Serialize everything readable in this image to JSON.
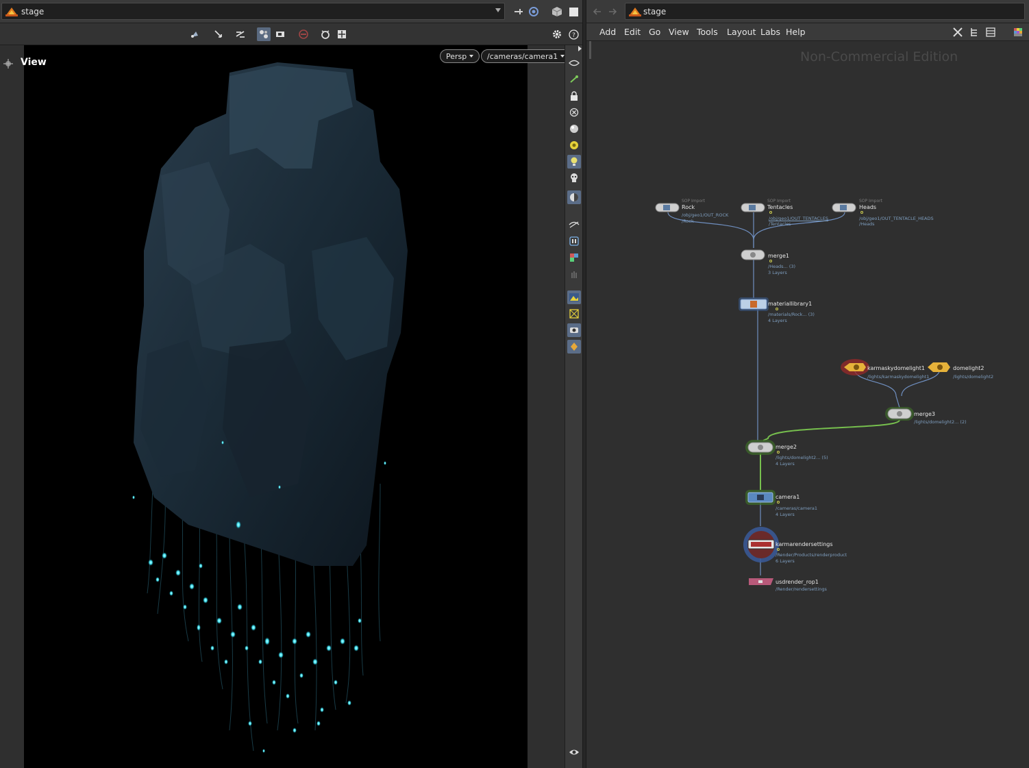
{
  "left_pane": {
    "path_label": "stage",
    "view_title": "View",
    "camera_mode": "Persp",
    "camera_path": "/cameras/camera1"
  },
  "right_pane": {
    "path_label": "stage",
    "menu": [
      "Add",
      "Edit",
      "Go",
      "View",
      "Tools",
      "Layout",
      "Labs",
      "Help"
    ],
    "watermark": "Non-Commercial Edition",
    "nodes": {
      "rock": {
        "type": "SOP Import",
        "name": "Rock",
        "sub1": "/obj/geo1/OUT_ROCK",
        "sub2": "/Rock"
      },
      "tentacles": {
        "type": "SOP Import",
        "name": "Tentacles",
        "sub1": "/obj/geo1/OUT_TENTACLES",
        "sub2": "/Tentacles"
      },
      "heads": {
        "type": "SOP Import",
        "name": "Heads",
        "sub1": "/obj/geo1/OUT_TENTACLE_HEADS",
        "sub2": "/Heads"
      },
      "merge1": {
        "name": "merge1",
        "sub1": "/Heads... (3)",
        "sub2": "3 Layers"
      },
      "materiallibrary1": {
        "name": "materiallibrary1",
        "sub1": "/materials/Rock... (3)",
        "sub2": "4 Layers"
      },
      "karmaskydomelight1": {
        "name": "karmaskydomelight1",
        "sub1": "/lights/karmaskydomelight1"
      },
      "domelight2": {
        "name": "domelight2",
        "sub1": "/lights/domelight2"
      },
      "merge3": {
        "name": "merge3",
        "sub1": "/lights/domelight2... (2)"
      },
      "merge2": {
        "name": "merge2",
        "sub1": "/lights/domelight2... (5)",
        "sub2": "4 Layers"
      },
      "camera1": {
        "name": "camera1",
        "sub1": "/cameras/camera1",
        "sub2": "4 Layers"
      },
      "karmarendersettings": {
        "name": "karmarendersettings",
        "sub1": "/Render/Products/renderproduct",
        "sub2": "6 Layers"
      },
      "usdrender_rop1": {
        "name": "usdrender_rop1",
        "sub1": "/Render/rendersettings"
      }
    }
  }
}
